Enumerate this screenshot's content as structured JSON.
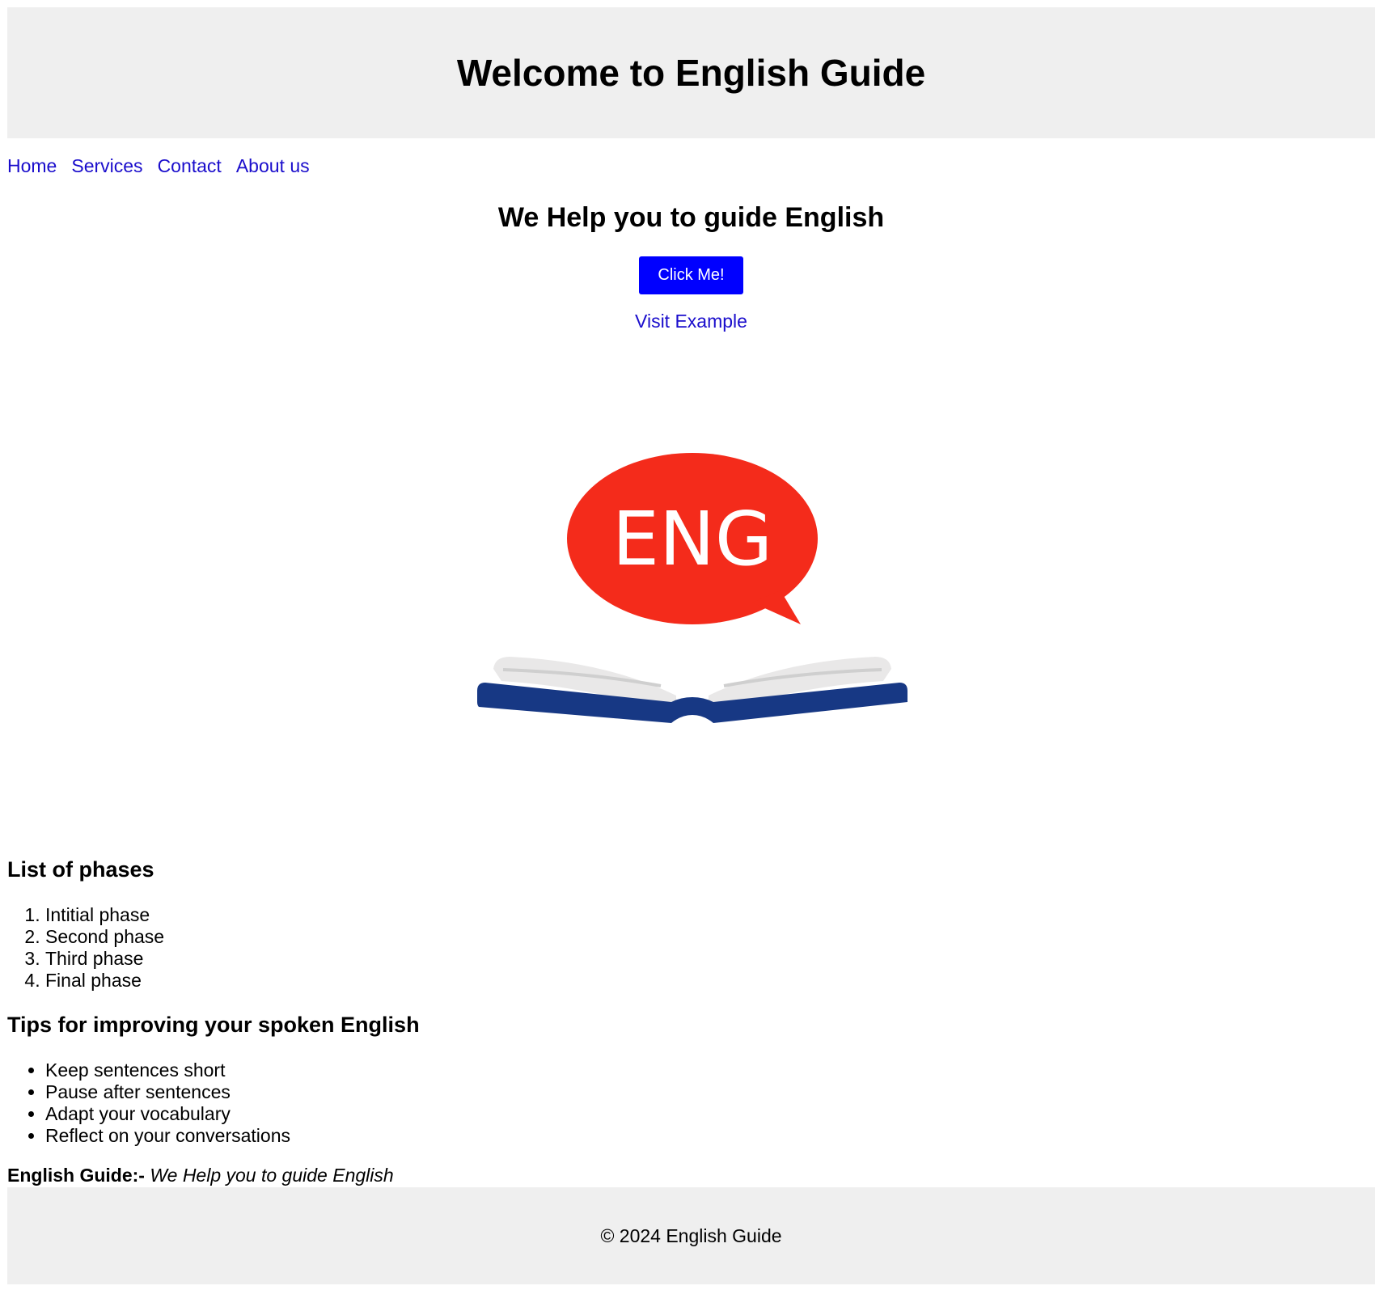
{
  "header": {
    "title": "Welcome to English Guide"
  },
  "nav": {
    "items": [
      {
        "label": "Home"
      },
      {
        "label": "Services"
      },
      {
        "label": "Contact"
      },
      {
        "label": "About us"
      }
    ]
  },
  "hero": {
    "heading": "We Help you to guide English",
    "button_label": "Click Me!",
    "link_label": "Visit Example"
  },
  "illustration": {
    "bubble_text": "ENG",
    "bubble_color": "#f42b1b",
    "book_cover_color": "#173884",
    "book_page_color": "#e9e8e8"
  },
  "phases": {
    "title": "List of phases",
    "items": [
      "Intitial phase",
      "Second phase",
      "Third phase",
      "Final phase"
    ]
  },
  "tips": {
    "title": "Tips for improving your spoken English",
    "items": [
      "Keep sentences short",
      "Pause after sentences",
      "Adapt your vocabulary",
      "Reflect on your conversations"
    ]
  },
  "tagline": {
    "brand": "English Guide:-",
    "text": "We Help you to guide English"
  },
  "footer": {
    "copyright": "© 2024 English Guide"
  },
  "colors": {
    "header_bg": "#efefef",
    "link": "#1a0dcc",
    "button_bg": "#0000ff"
  }
}
